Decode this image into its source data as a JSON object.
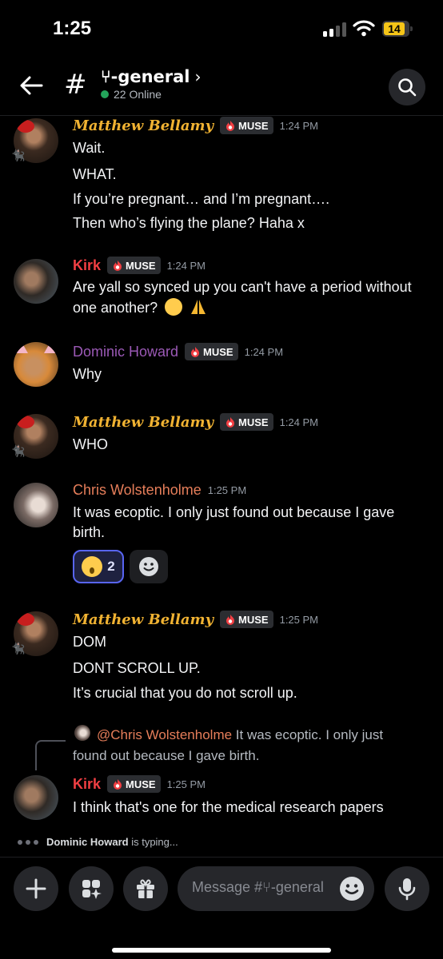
{
  "status_bar": {
    "time": "1:25",
    "battery": "14"
  },
  "header": {
    "channel_name": "⑂-general",
    "online_count": "22 Online"
  },
  "tags": {
    "muse": "MUSE"
  },
  "messages": [
    {
      "author": "Matthew Bellamy",
      "timestamp": "1:24 PM",
      "lines": [
        "Wait.",
        "WHAT.",
        "If you’re pregnant… and I’m pregnant….",
        "Then who’s flying the plane? Haha x"
      ]
    },
    {
      "author": "Kirk",
      "timestamp": "1:24 PM",
      "lines": [
        "Are yall so synced up you can't have a period without",
        "one another?"
      ]
    },
    {
      "author": "Dominic Howard",
      "timestamp": "1:24 PM",
      "lines": [
        "Why"
      ]
    },
    {
      "author": "Matthew Bellamy",
      "timestamp": "1:24 PM",
      "lines": [
        "WHO"
      ]
    },
    {
      "author": "Chris Wolstenholme",
      "timestamp": "1:25 PM",
      "lines": [
        "It was ecoptic. I only just found out because I gave",
        "birth."
      ],
      "reactions": [
        {
          "emoji": "astonished-face",
          "count": "2"
        }
      ]
    },
    {
      "author": "Matthew Bellamy",
      "timestamp": "1:25 PM",
      "lines": [
        "DOM",
        "DONT SCROLL UP.",
        "It’s crucial that you do not scroll up."
      ]
    },
    {
      "author": "Kirk",
      "timestamp": "1:25 PM",
      "reply_author": "@Chris Wolstenholme",
      "reply_text_1": "It was ecoptic. I only just",
      "reply_text_2": "found out because I gave birth.",
      "lines": [
        "I think that's one for the medical research papers"
      ]
    }
  ],
  "typing": {
    "user": "Dominic Howard",
    "suffix": "is typing..."
  },
  "composer": {
    "placeholder": "Message #⑂-general"
  },
  "colors": {
    "background": "#000000",
    "accent": "#5865f2",
    "online": "#23a55a",
    "bellamy": "#f0b232",
    "kirk": "#f23f43",
    "dominic": "#9b59b6",
    "chris": "#e67e5a"
  },
  "icons": [
    "back-arrow-icon",
    "hash-icon",
    "chevron-right-icon",
    "search-icon",
    "flame-icon",
    "plus-icon",
    "sparkles-icon",
    "gift-icon",
    "smile-icon",
    "microphone-icon"
  ]
}
